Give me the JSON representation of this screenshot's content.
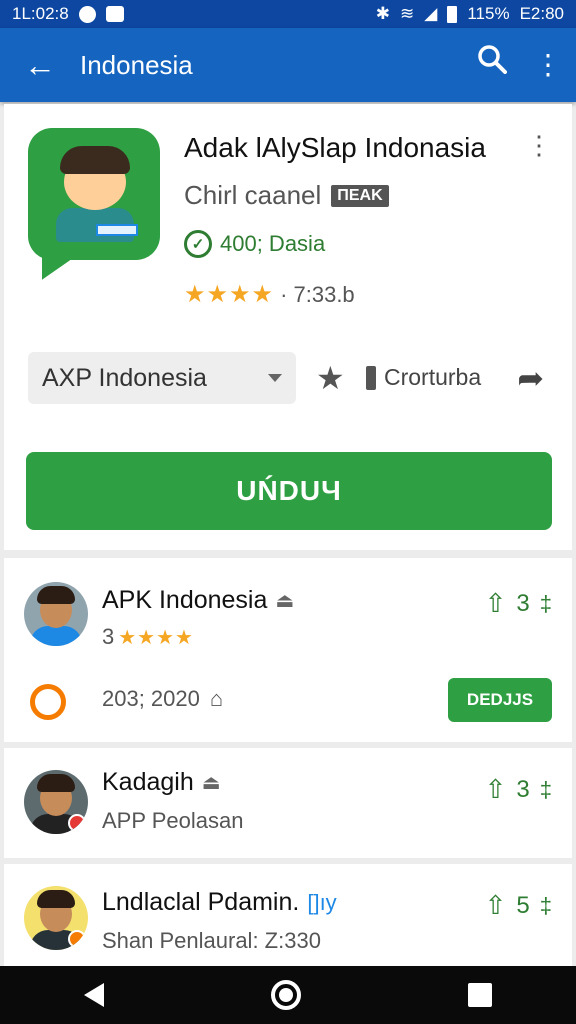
{
  "status_bar": {
    "time_left": "1L:02:8",
    "battery": "115%",
    "time_right": "E2:80"
  },
  "appbar": {
    "back_icon": "←",
    "title": "Indonesia",
    "search_icon": "⚲",
    "more_icon": "⋮"
  },
  "app": {
    "title": "Adak lAlyЅlap Indonasia",
    "developer": "Chirl caanel",
    "developer_tag": "ΠΕΑΚ",
    "verified_text": "400; Dasia",
    "stars": "★★★★",
    "rating_suffix": "· 7:33.b",
    "more_icon": "⋮"
  },
  "controls": {
    "select_value": "AXP Indonesia",
    "star_icon": "★",
    "compare_label": "Crorturba",
    "share_icon": "➦",
    "install_label": "UŃDUЧ"
  },
  "reviews": [
    {
      "name": "APK Indonesia",
      "name_icon": "⏏",
      "rating_num": "3",
      "stars": "★★★★",
      "like_count": "3",
      "date": "203; 2020",
      "reply_label": "DEDJJS"
    },
    {
      "name": "Kadagih",
      "name_icon": "⏏",
      "subtitle": "APP Peolasan",
      "like_count": "3"
    },
    {
      "name": "Lndlaclal Pdamin.",
      "name_tag": "[]ıy",
      "subtitle": "Shan Penlaural: Z:330",
      "like_count": "5"
    }
  ],
  "icons": {
    "like_icon": "⇧",
    "pin_icon": "‡",
    "home_icon": "⌂"
  },
  "colors": {
    "status_bar": "#0d47a1",
    "app_bar": "#1565c0",
    "accent_green": "#2ea043",
    "star": "#f5a623"
  }
}
